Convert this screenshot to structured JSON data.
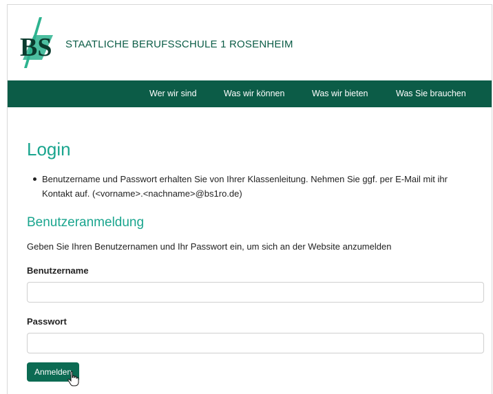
{
  "header": {
    "logo_text": "BS",
    "school_name": "STAATLICHE BERUFSSCHULE 1 ROSENHEIM"
  },
  "nav": {
    "items": [
      {
        "label": "Wer wir sind"
      },
      {
        "label": "Was wir können"
      },
      {
        "label": "Was wir bieten"
      },
      {
        "label": "Was Sie brauchen"
      }
    ]
  },
  "main": {
    "title": "Login",
    "notes": [
      "Benutzername und Passwort erhalten Sie von Ihrer Klassenleitung. Nehmen Sie ggf. per E-Mail mit ihr Kontakt auf. (<vorname>.<nachname>@bs1ro.de)"
    ],
    "section_title": "Benutzeranmeldung",
    "intro": "Geben Sie Ihren Benutzernamen und Ihr Passwort ein, um sich an der Website anzumelden",
    "username_label": "Benutzername",
    "username_value": "",
    "password_label": "Passwort",
    "password_value": "",
    "submit_label": "Anmelden"
  },
  "colors": {
    "brand_dark_green": "#0c5c47",
    "accent_teal": "#1aa58e",
    "button_green": "#0c6b53"
  },
  "icons": {
    "cursor": "hand-pointer-icon"
  }
}
